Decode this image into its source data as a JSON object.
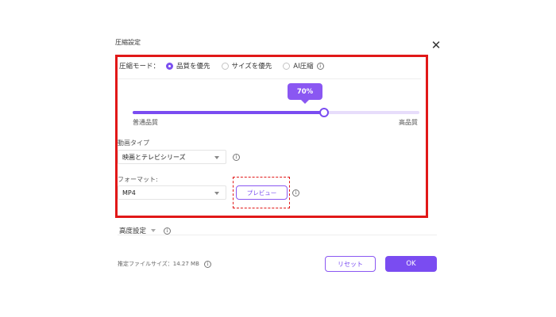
{
  "dialog": {
    "title": "圧縮設定",
    "close_glyph": "✕"
  },
  "mode": {
    "label": "圧縮モード：",
    "options": [
      {
        "label": "品質を優先",
        "selected": true
      },
      {
        "label": "サイズを優先",
        "selected": false
      },
      {
        "label": "AI圧縮",
        "selected": false
      }
    ],
    "info_glyph": "i"
  },
  "quality": {
    "value_text": "70%",
    "value": 0.7,
    "min_label": "普通品質",
    "max_label": "高品質"
  },
  "video_type": {
    "label": "動画タイプ",
    "value": "映画とテレビシリーズ"
  },
  "format": {
    "label": "フォーマット:",
    "value": "MP4",
    "preview_label": "プレビュー"
  },
  "advanced": {
    "label": "高度設定"
  },
  "footer": {
    "estimate_label": "推定ファイルサイズ：14.27 MB",
    "reset_label": "リセット",
    "ok_label": "OK"
  },
  "colors": {
    "accent": "#7a4cf1",
    "highlight": "#e11818"
  },
  "icons": [
    "close-icon",
    "info-icon",
    "chevron-down-icon"
  ]
}
